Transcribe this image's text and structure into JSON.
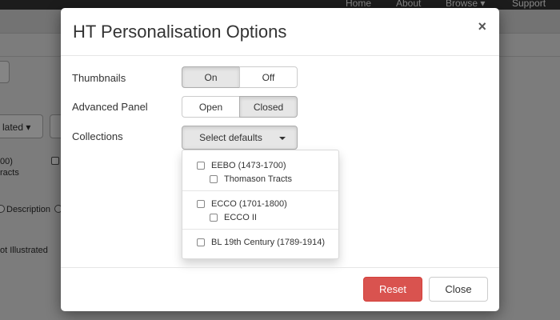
{
  "background": {
    "nav_links": [
      "Home",
      "About",
      "Browse ▾",
      "Support"
    ],
    "left_labels": [
      "lated ▾",
      "00)",
      "racts",
      "Description",
      "ot Illustrated"
    ]
  },
  "modal": {
    "title": "HT Personalisation Options",
    "close_glyph": "×",
    "thumbnails": {
      "label": "Thumbnails",
      "options": [
        "On",
        "Off"
      ],
      "selected": "On"
    },
    "advanced_panel": {
      "label": "Advanced Panel",
      "options": [
        "Open",
        "Closed"
      ],
      "selected": "Closed"
    },
    "collections": {
      "label": "Collections",
      "button_label": "Select defaults",
      "groups": [
        {
          "name": "EEBO (1473-1700)",
          "children": [
            "Thomason Tracts"
          ]
        },
        {
          "name": "ECCO (1701-1800)",
          "children": [
            "ECCO II"
          ]
        },
        {
          "name": "BL 19th Century (1789-1914)",
          "children": []
        }
      ]
    },
    "footer": {
      "reset_label": "Reset",
      "close_label": "Close"
    }
  },
  "colors": {
    "danger": "#d9534f",
    "active_segment": "#e6e6e6",
    "backdrop": "#7a7a7a"
  }
}
